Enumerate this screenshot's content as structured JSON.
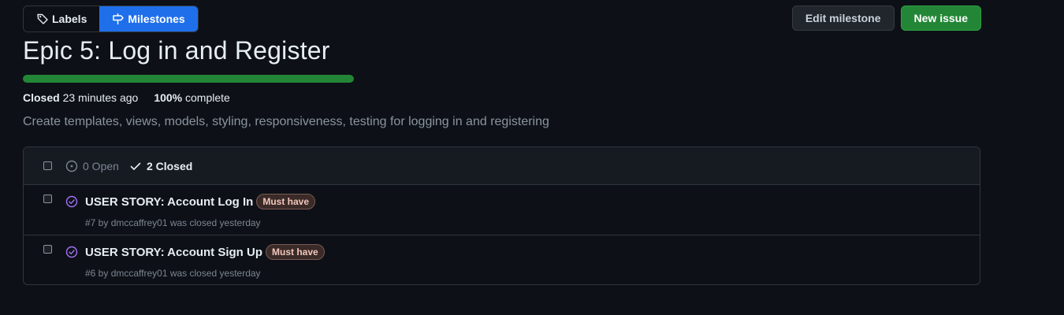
{
  "subnav": {
    "labels": "Labels",
    "milestones": "Milestones"
  },
  "actions": {
    "edit_milestone": "Edit milestone",
    "new_issue": "New issue"
  },
  "milestone": {
    "title": "Epic 5: Log in and Register",
    "progress_fraction": 1.0,
    "closed_label": "Closed",
    "closed_time": "23 minutes ago",
    "percent": "100%",
    "complete_label": "complete",
    "description": "Create templates, views, models, styling, responsiveness, testing for logging in and registering"
  },
  "issues_header": {
    "open_label": "0 Open",
    "closed_label": "2 Closed"
  },
  "issues": [
    {
      "title": "USER STORY: Account Log In",
      "label": "Must have",
      "meta": "#7 by dmccaffrey01 was closed yesterday"
    },
    {
      "title": "USER STORY: Account Sign Up",
      "label": "Must have",
      "meta": "#6 by dmccaffrey01 was closed yesterday"
    }
  ],
  "colors": {
    "accent": "#1f6feb",
    "success": "#238636",
    "closed_icon": "#a371f7",
    "label_bg": "#3a2a28",
    "label_text": "#f3c7bb"
  },
  "icons": {
    "labels": "tag-icon",
    "milestones": "milestone-icon",
    "open": "issue-open-icon",
    "closed": "check-icon",
    "issue_closed": "issue-closed-icon"
  }
}
